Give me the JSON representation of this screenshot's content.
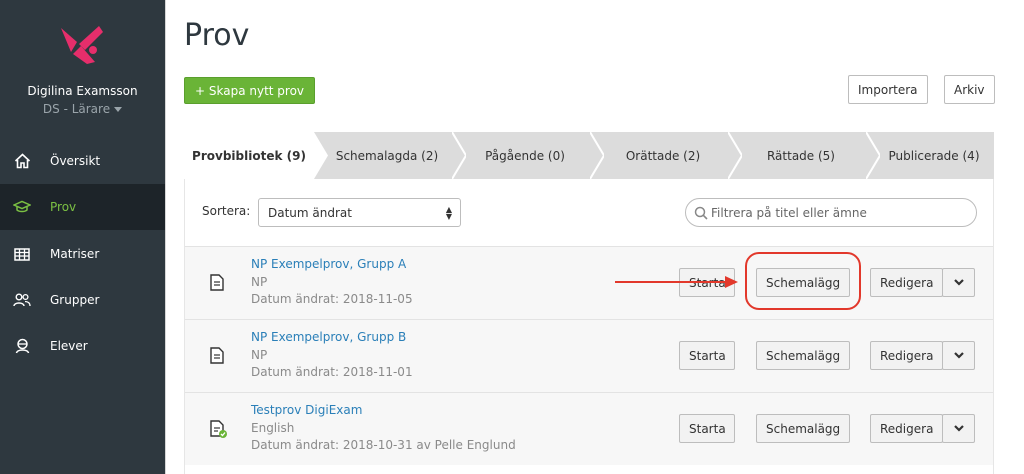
{
  "sidebar": {
    "user_name": "Digilina Examsson",
    "user_role": "DS - Lärare",
    "brand_color": "#e62e6b",
    "active_color": "#7bc043",
    "items": [
      {
        "label": "Översikt",
        "icon": "home-icon",
        "active": false
      },
      {
        "label": "Prov",
        "icon": "graduation-cap-icon",
        "active": true
      },
      {
        "label": "Matriser",
        "icon": "table-icon",
        "active": false
      },
      {
        "label": "Grupper",
        "icon": "users-icon",
        "active": false
      },
      {
        "label": "Elever",
        "icon": "student-icon",
        "active": false
      }
    ]
  },
  "main": {
    "title": "Prov",
    "create_label": "+ Skapa nytt prov",
    "import_label": "Importera",
    "archive_label": "Arkiv",
    "tabs": [
      {
        "label": "Provbibliotek (9)",
        "active": true
      },
      {
        "label": "Schemalagda (2)",
        "active": false
      },
      {
        "label": "Pågående (0)",
        "active": false
      },
      {
        "label": "Orättade (2)",
        "active": false
      },
      {
        "label": "Rättade (5)",
        "active": false
      },
      {
        "label": "Publicerade (4)",
        "active": false
      }
    ],
    "sort_label": "Sortera:",
    "sort_value": "Datum ändrat",
    "filter_placeholder": "Filtrera på titel eller ämne",
    "row_actions": {
      "start": "Starta",
      "schedule": "Schemalägg",
      "edit": "Redigera"
    },
    "exams": [
      {
        "title": "NP Exempelprov, Grupp A",
        "subject": "NP",
        "date": "Datum ändrat: 2018-11-05",
        "icon": "document-icon"
      },
      {
        "title": "NP Exempelprov, Grupp B",
        "subject": "NP",
        "date": "Datum ändrat: 2018-11-01",
        "icon": "document-icon"
      },
      {
        "title": "Testprov DigiExam",
        "subject": "English",
        "date": "Datum ändrat: 2018-10-31 av Pelle Englund",
        "icon": "document-check-icon"
      }
    ]
  }
}
